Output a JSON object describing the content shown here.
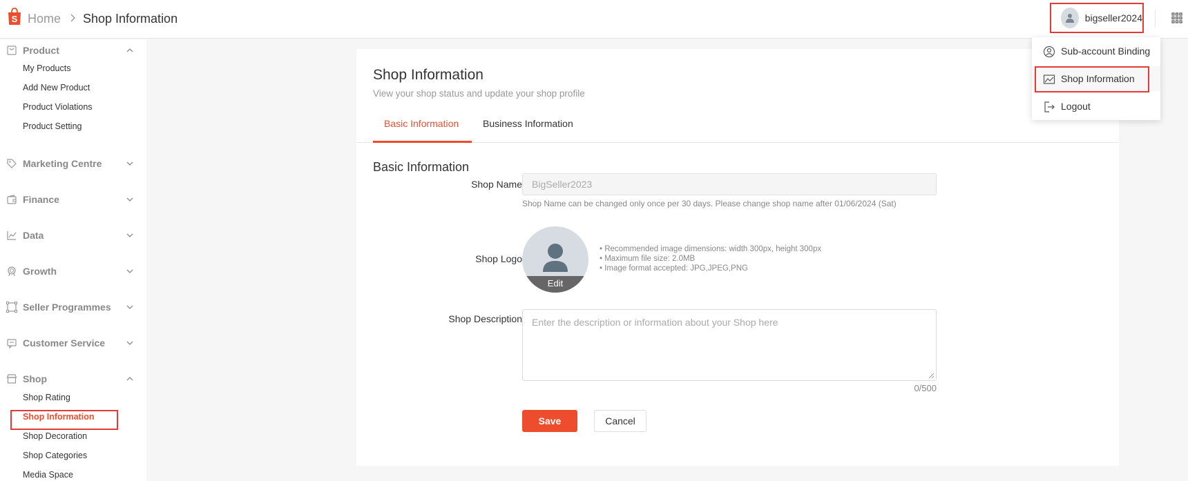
{
  "header": {
    "breadcrumb_home": "Home",
    "breadcrumb_current": "Shop Information",
    "username": "bigseller2024",
    "brand_color": "#ee4d2d"
  },
  "sidebar": {
    "sections": [
      {
        "label": "Product",
        "icon": "product-icon",
        "expanded": true,
        "items": [
          "My Products",
          "Add New Product",
          "Product Violations",
          "Product Setting"
        ]
      },
      {
        "label": "Marketing Centre",
        "icon": "tag-icon",
        "expanded": false
      },
      {
        "label": "Finance",
        "icon": "wallet-icon",
        "expanded": false
      },
      {
        "label": "Data",
        "icon": "chart-icon",
        "expanded": false
      },
      {
        "label": "Growth",
        "icon": "medal-icon",
        "expanded": false
      },
      {
        "label": "Seller Programmes",
        "icon": "programmes-icon",
        "expanded": false
      },
      {
        "label": "Customer Service",
        "icon": "chat-icon",
        "expanded": false
      },
      {
        "label": "Shop",
        "icon": "shop-icon",
        "expanded": true,
        "items": [
          "Shop Rating",
          "Shop Information",
          "Shop Decoration",
          "Shop Categories",
          "Media Space"
        ],
        "active_item": "Shop Information"
      }
    ]
  },
  "main": {
    "title": "Shop Information",
    "subtitle": "View your shop status and update your shop profile",
    "tabs": [
      {
        "label": "Basic Information",
        "active": true
      },
      {
        "label": "Business Information",
        "active": false
      }
    ],
    "section_title": "Basic Information",
    "shop_name_label": "Shop Name",
    "shop_name_value": "BigSeller2023",
    "shop_name_hint": "Shop Name can be changed only once per 30 days. Please change shop name after 01/06/2024 (Sat)",
    "shop_logo_label": "Shop Logo",
    "logo_edit": "Edit",
    "logo_notes": [
      "• Recommended image dimensions: width 300px, height 300px",
      "• Maximum file size: 2.0MB",
      "• Image format accepted: JPG,JPEG,PNG"
    ],
    "description_label": "Shop Description",
    "description_placeholder": "Enter the description or information about your Shop here",
    "description_counter": "0/500",
    "save_label": "Save",
    "cancel_label": "Cancel"
  },
  "dropdown": {
    "items": [
      {
        "label": "Sub-account Binding",
        "icon": "user-circle-icon"
      },
      {
        "label": "Shop Information",
        "icon": "shop-info-icon"
      },
      {
        "label": "Logout",
        "icon": "logout-icon"
      }
    ]
  }
}
